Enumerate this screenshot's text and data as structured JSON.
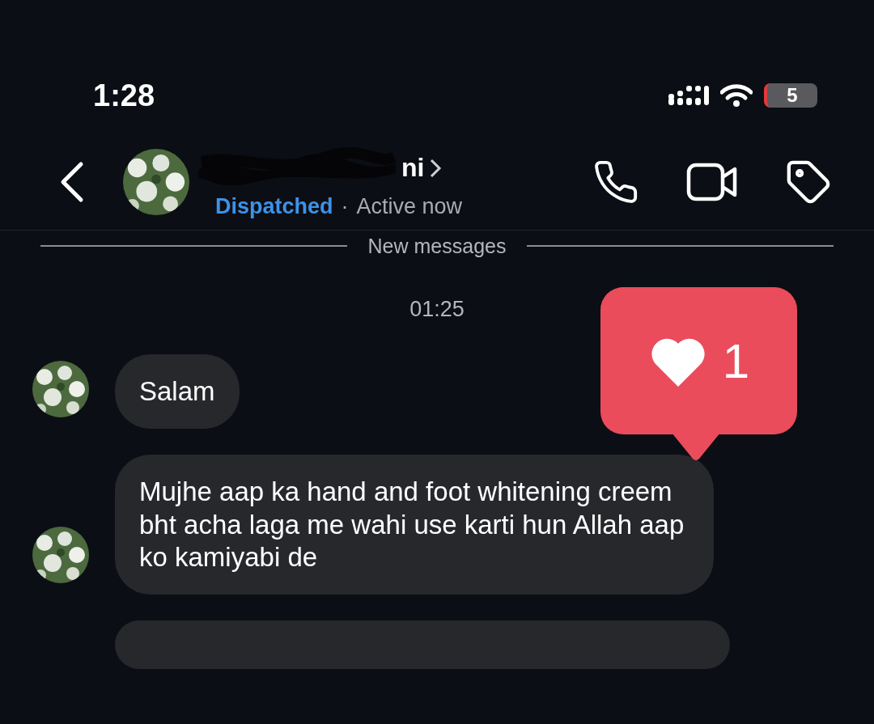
{
  "status_bar": {
    "time": "1:28",
    "battery": "5"
  },
  "header": {
    "name": "ni",
    "status": "Dispatched",
    "separator": "·",
    "presence": "Active now"
  },
  "divider_label": "New messages",
  "timestamp": "01:25",
  "notification": {
    "count": "1"
  },
  "messages": [
    {
      "text": "Salam"
    },
    {
      "text": "Mujhe aap ka hand and foot whitening creem bht acha laga me wahi use karti hun Allah aap ko kamiyabi de"
    }
  ],
  "more_below": true
}
